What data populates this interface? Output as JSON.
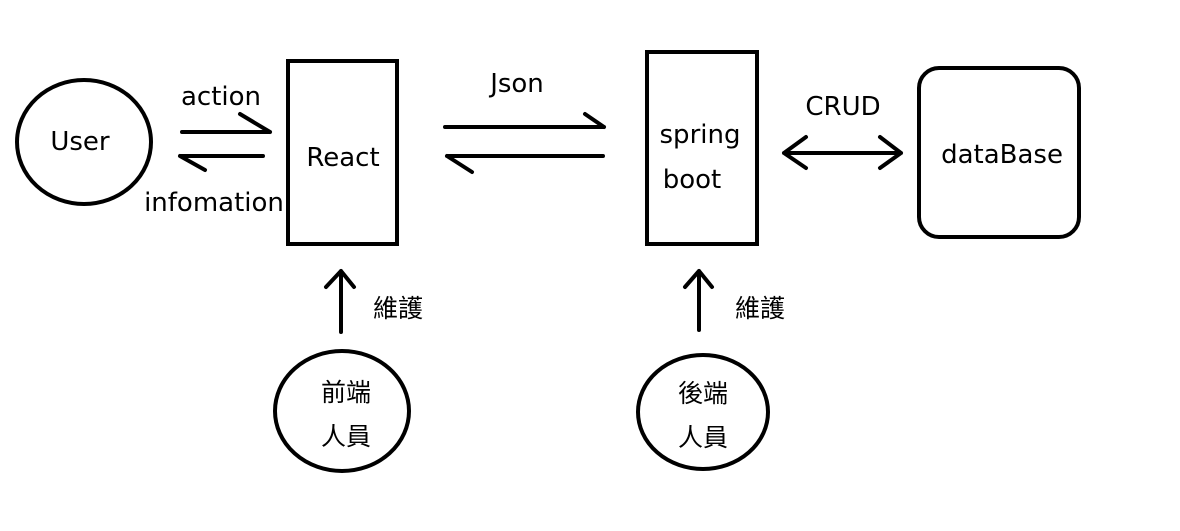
{
  "nodes": {
    "user": "User",
    "react": "React",
    "spring_line1": "spring",
    "spring_line2": "boot",
    "database": "dataBase",
    "frontend_line1": "前端",
    "frontend_line2": "人員",
    "backend_line1": "後端",
    "backend_line2": "人員"
  },
  "edges": {
    "action": "action",
    "information": "infomation",
    "json": "Json",
    "crud": "CRUD",
    "maintain_frontend": "維護",
    "maintain_backend": "維護"
  }
}
